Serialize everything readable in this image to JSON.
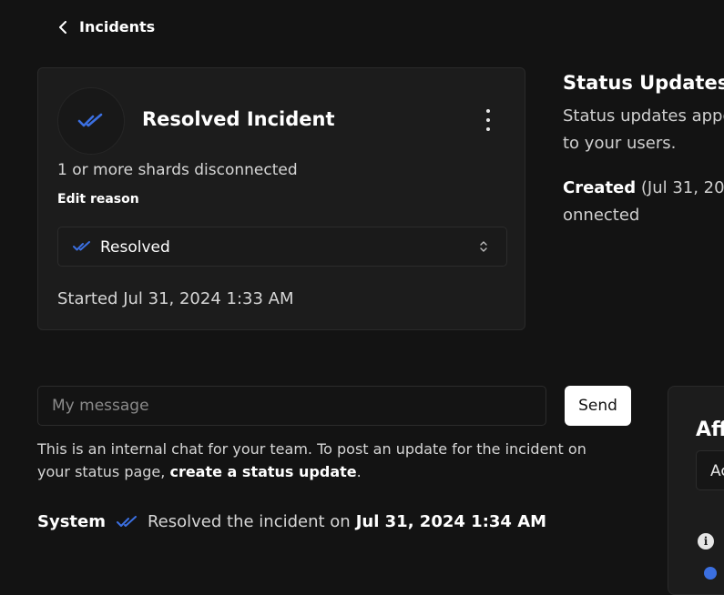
{
  "nav": {
    "back_label": "Incidents"
  },
  "incident": {
    "title": "Resolved Incident",
    "description": "1 or more shards disconnected",
    "edit_reason_label": "Edit reason",
    "status_select": {
      "value": "Resolved"
    },
    "started": "Started Jul 31, 2024 1:33 AM"
  },
  "status_updates": {
    "title": "Status Updates",
    "body_line1": "Status updates appe",
    "body_line2": "to your users.",
    "created_label": "Created",
    "created_rest": " (Jul 31, 202",
    "created_line2": "onnected"
  },
  "chat": {
    "placeholder": "My message",
    "send_label": "Send",
    "note_text": "This is an internal chat for your team. To post an update for the incident on your status page, ",
    "note_link": "create a status update",
    "note_end": "."
  },
  "log": {
    "author": "System",
    "text": "Resolved the incident on",
    "timestamp": "Jul 31, 2024 1:34 AM"
  },
  "affected": {
    "title_partial": "Aff",
    "select_partial": "Ac"
  },
  "icons": {
    "back": "chevron-left-icon",
    "resolved": "double-check-icon",
    "menu": "kebab-menu-icon",
    "select": "chevron-up-down-icon",
    "info": "info-icon"
  },
  "colors": {
    "accent_blue": "#3b6fe0",
    "background": "#131313",
    "card": "#1c1c1c"
  }
}
